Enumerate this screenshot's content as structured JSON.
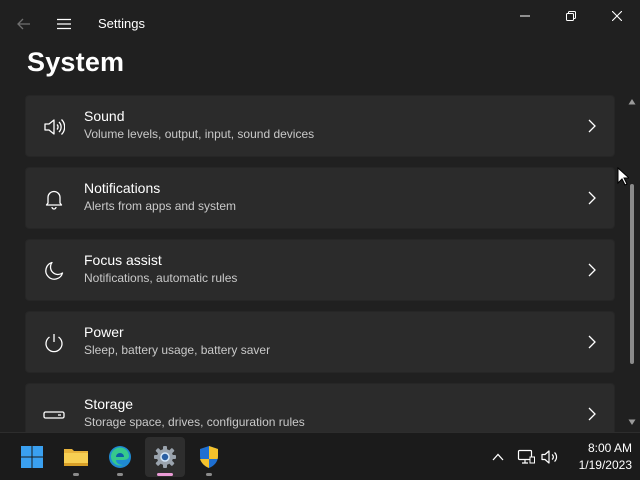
{
  "window": {
    "title": "Settings"
  },
  "page": {
    "title": "System"
  },
  "items": [
    {
      "title": "Sound",
      "subtitle": "Volume levels, output, input, sound devices",
      "icon": "speaker-icon"
    },
    {
      "title": "Notifications",
      "subtitle": "Alerts from apps and system",
      "icon": "bell-icon"
    },
    {
      "title": "Focus assist",
      "subtitle": "Notifications, automatic rules",
      "icon": "moon-icon"
    },
    {
      "title": "Power",
      "subtitle": "Sleep, battery usage, battery saver",
      "icon": "power-icon"
    },
    {
      "title": "Storage",
      "subtitle": "Storage space, drives, configuration rules",
      "icon": "storage-icon"
    }
  ],
  "taskbar": {
    "apps": [
      "start-icon",
      "file-explorer-icon",
      "edge-icon",
      "settings-icon",
      "security-icon"
    ],
    "active_app": "settings-icon",
    "tray": [
      "chevron-up-icon",
      "network-icon",
      "volume-icon"
    ],
    "time": "8:00 AM",
    "date": "1/19/2023"
  },
  "colors": {
    "window_bg": "#202020",
    "card_bg": "#2b2b2b",
    "taskbar_bg": "#1b1b1b",
    "accent": "#ea9bd6"
  }
}
